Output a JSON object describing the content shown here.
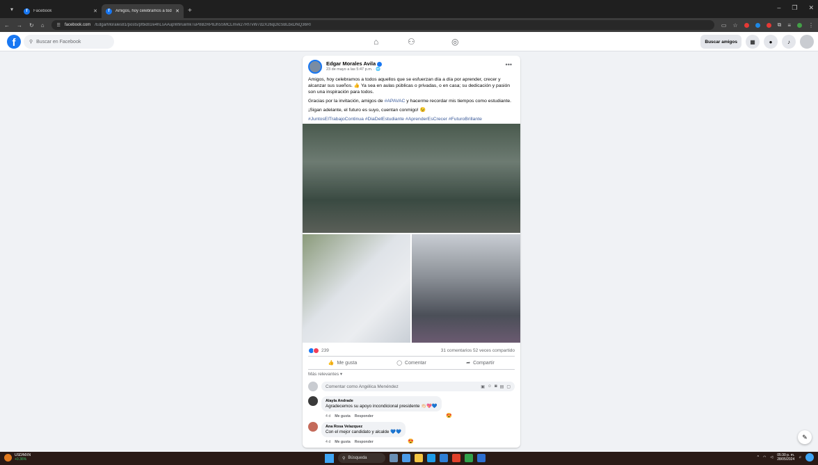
{
  "browser": {
    "tabs": [
      {
        "label": "Facebook",
        "active": false
      },
      {
        "label": "Amigos, hoy celebramos a tod…",
        "active": true
      }
    ],
    "url_host": "facebook.com",
    "url_path": "/EdgarMorales81/posts/pfbid02e4hLsAAupW9ruiimkTuP8BzRP8Jh5SMCLmvk27Rf7vW7d2X26qDtcSBLbxDNQ36RI"
  },
  "fb": {
    "search_placeholder": "Buscar en Facebook",
    "find_friends": "Buscar amigos"
  },
  "post": {
    "author": "Edgar Morales Avila",
    "date": "23 de mayo a las 5:47 p.m. · 🌐",
    "paragraph1": "Amigos, hoy celebramos a todos aquellos que se esfuerzan día a día por aprender, crecer y alcanzar sus sueños. 👍 Ya sea en aulas públicas o privadas, o en casa; su dedicación y pasión son una inspiración para todos.",
    "paragraph2_before": "Gracias por la invitación, amigos de ",
    "paragraph2_tag": "#APAVAC",
    "paragraph2_after": " y hacerme recordar mis tiempos como estudiante.",
    "paragraph3": "¡Sigan adelante, el futuro es suyo, cuentan conmigo! 😉",
    "hashtags": "#JuntosElTrabajoContinua #DiaDelEstudiante #AprenderEsCrecer #FuturoBrillante",
    "reactions_count": "239",
    "stats": "31 comentarios  52 veces compartido",
    "like_label": "Me gusta",
    "comment_label": "Comentar",
    "share_label": "Compartir",
    "sort_label": "Más relevantes ▾",
    "comment_placeholder": "Comentar como Angélica Menéndez"
  },
  "comments": [
    {
      "name": "Alayla Andrade",
      "text": "Agradecemos su apoyo incondicional presidente 👏🏻💖💙",
      "time": "4 d",
      "like": "Me gusta",
      "reply": "Responder",
      "reaction": "😍"
    },
    {
      "name": "Ana Rosa Velazquez",
      "text": "Con el mejor candidato y alcalde 💙💙",
      "time": "4 d",
      "like": "Me gusta",
      "reply": "Responder",
      "reaction": "😍"
    }
  ],
  "taskbar": {
    "weather_label": "USD/MXN",
    "weather_value": "+0.36%",
    "search_label": "Búsqueda",
    "time": "05:30 p. m.",
    "date": "28/05/2024"
  }
}
